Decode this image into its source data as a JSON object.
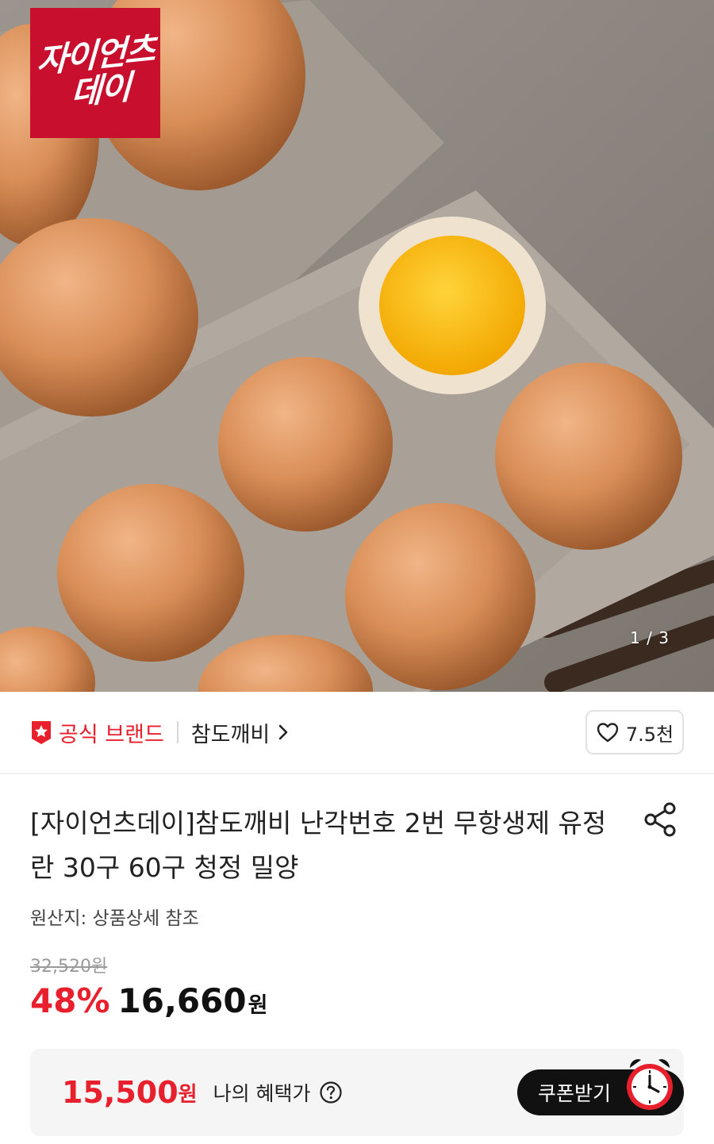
{
  "hero": {
    "promo_logo_line1": "자이언츠",
    "promo_logo_line2": "데이",
    "page_indicator": "1 / 3"
  },
  "brand_bar": {
    "official_label": "공식 브랜드",
    "store_name": "참도깨비",
    "like_count": "7.5천"
  },
  "product": {
    "title": "[자이언츠데이]참도깨비 난각번호 2번 무항생제 유정란 30구 60구 청정 밀양",
    "origin": "원산지: 상품상세 참조",
    "original_price": "32,520원",
    "discount_rate": "48%",
    "sale_price": "16,660",
    "price_unit": "원"
  },
  "benefit": {
    "price": "15,500",
    "unit": "원",
    "label": "나의 혜택가",
    "coupon_button": "쿠폰받기"
  },
  "icons": {
    "official_badge": "star-shield-icon",
    "chevron": "chevron-right-icon",
    "heart": "heart-icon",
    "share": "share-icon",
    "help": "question-circle-icon",
    "clock": "alarm-clock-icon"
  },
  "colors": {
    "accent_red": "#e8202e",
    "promo_red": "#c8102e",
    "coupon_button_bg": "#111111"
  }
}
